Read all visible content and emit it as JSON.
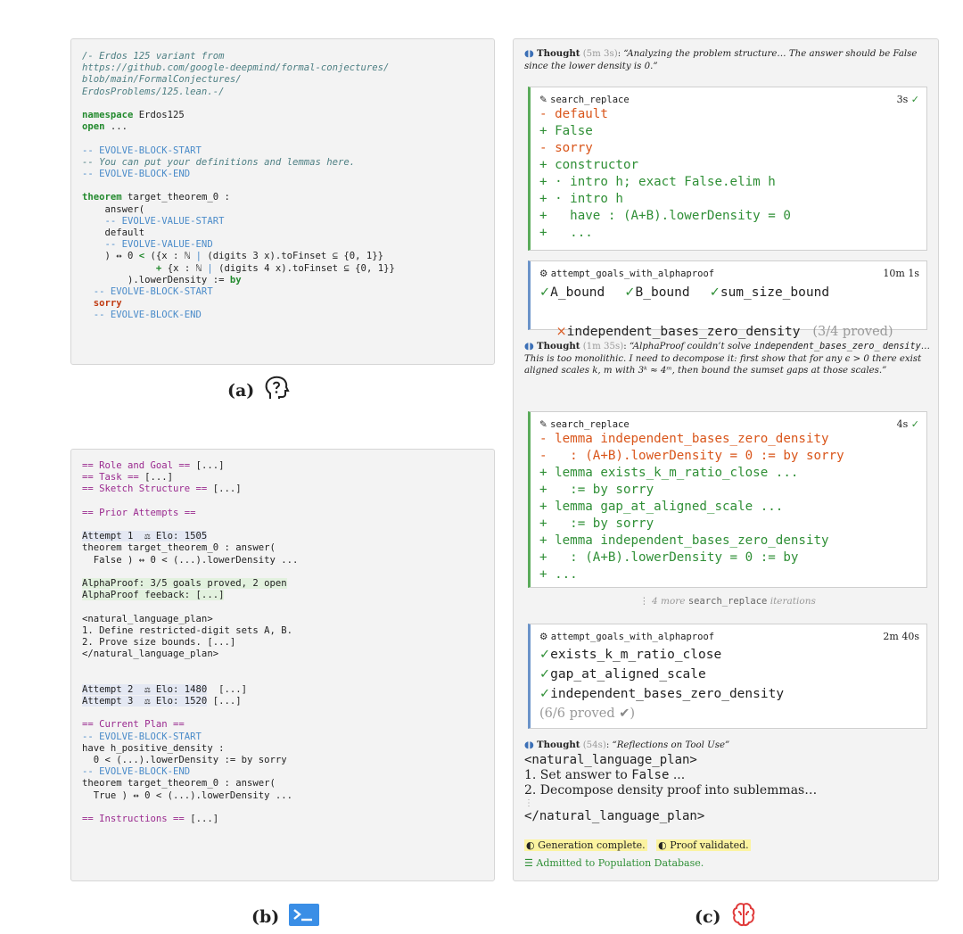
{
  "panel_a": {
    "lines": [
      [
        {
          "t": "/- Erdos 125 variant from",
          "c": "cmi"
        }
      ],
      [
        {
          "t": "https://github.com/google-deepmind/formal-conjectures/",
          "c": "cmi"
        }
      ],
      [
        {
          "t": "blob/main/FormalConjectures/",
          "c": "cmi"
        }
      ],
      [
        {
          "t": "ErdosProblems/125.lean.-/",
          "c": "cmi"
        }
      ],
      [],
      [
        {
          "t": "namespace",
          "c": "kw"
        },
        {
          "t": " Erdos125"
        }
      ],
      [
        {
          "t": "open",
          "c": "kw"
        },
        {
          "t": " ..."
        }
      ],
      [],
      [
        {
          "t": "-- EVOLVE-BLOCK-START",
          "c": "cm"
        }
      ],
      [
        {
          "t": "-- You can put your definitions and lemmas here.",
          "c": "cmi"
        }
      ],
      [
        {
          "t": "-- EVOLVE-BLOCK-END",
          "c": "cm"
        }
      ],
      [],
      [
        {
          "t": "theorem",
          "c": "kw"
        },
        {
          "t": " target_theorem_0 :"
        }
      ],
      [
        {
          "t": "    answer("
        }
      ],
      [
        {
          "t": "    -- EVOLVE-VALUE-START",
          "c": "cm"
        }
      ],
      [
        {
          "t": "    default"
        }
      ],
      [
        {
          "t": "    -- EVOLVE-VALUE-END",
          "c": "cm"
        }
      ],
      [
        {
          "t": "    ) ↔ 0 "
        },
        {
          "t": "<",
          "c": "kw"
        },
        {
          "t": " ({x : ℕ "
        },
        {
          "t": "|",
          "c": "cm"
        },
        {
          "t": " (digits 3 x).toFinset ⊆ {0, 1}}"
        }
      ],
      [
        {
          "t": "             "
        },
        {
          "t": "+",
          "c": "kw"
        },
        {
          "t": " {x : ℕ "
        },
        {
          "t": "|",
          "c": "cm"
        },
        {
          "t": " (digits 4 x).toFinset ⊆ {0, 1}}"
        }
      ],
      [
        {
          "t": "        ).lowerDensity := "
        },
        {
          "t": "by",
          "c": "kw"
        }
      ],
      [
        {
          "t": "  -- EVOLVE-BLOCK-START",
          "c": "cm"
        }
      ],
      [
        {
          "t": "  sorry",
          "c": "red"
        }
      ],
      [
        {
          "t": "  -- EVOLVE-BLOCK-END",
          "c": "cm"
        }
      ]
    ]
  },
  "caption_a": "(a)",
  "panel_b": {
    "lines": [
      [
        {
          "t": "== Role and Goal ==",
          "c": "pu"
        },
        {
          "t": " [...]"
        }
      ],
      [
        {
          "t": "== Task ==",
          "c": "pu"
        },
        {
          "t": " [...]"
        }
      ],
      [
        {
          "t": "== Sketch Structure ==",
          "c": "pu"
        },
        {
          "t": " [...]"
        }
      ],
      [],
      [
        {
          "t": "== Prior Attempts ==",
          "c": "pu"
        }
      ],
      [],
      [
        {
          "t": "Attempt 1  ⚖ Elo: 1505",
          "h": "blue"
        }
      ],
      [
        {
          "t": "theorem target_theorem_0 : answer("
        }
      ],
      [
        {
          "t": "  False ) ↔ 0 < (...).lowerDensity ..."
        }
      ],
      [],
      [
        {
          "t": "AlphaProof: 3/5 goals proved, 2 open",
          "h": "green"
        }
      ],
      [
        {
          "t": "AlphaProof feeback: [...]",
          "h": "green"
        }
      ],
      [],
      [
        {
          "t": "<natural_language_plan>"
        }
      ],
      [
        {
          "t": "1. Define restricted-digit sets A, B."
        }
      ],
      [
        {
          "t": "2. Prove size bounds. [...]"
        }
      ],
      [
        {
          "t": "</natural_language_plan>"
        }
      ],
      [],
      [],
      [
        {
          "t": "Attempt 2  ⚖ Elo: 1480",
          "h": "blue"
        },
        {
          "t": "  [...]"
        }
      ],
      [
        {
          "t": "Attempt 3  ⚖ Elo: 1520",
          "h": "blue"
        },
        {
          "t": " [...]"
        }
      ],
      [],
      [
        {
          "t": "== Current Plan ==",
          "c": "pu"
        }
      ],
      [
        {
          "t": "-- EVOLVE-BLOCK-START",
          "c": "cm"
        }
      ],
      [
        {
          "t": "have h_positive_density :"
        }
      ],
      [
        {
          "t": "  0 < (...).lowerDensity := by sorry"
        }
      ],
      [
        {
          "t": "-- EVOLVE-BLOCK-END",
          "c": "cm"
        }
      ],
      [
        {
          "t": "theorem target_theorem_0 : answer("
        }
      ],
      [
        {
          "t": "  True ) ↔ 0 < (...).lowerDensity ..."
        }
      ],
      [],
      [
        {
          "t": "== Instructions ==",
          "c": "pu"
        },
        {
          "t": " [...]"
        }
      ]
    ]
  },
  "caption_b": "(b)",
  "panel_c": {
    "thought1": {
      "label": "Thought",
      "time": "(5m 3s)",
      "text": "“Analyzing the problem structure… The answer should be False since the lower density is 0.”"
    },
    "edit1": {
      "name": "search_replace",
      "time": "3s",
      "lines": [
        {
          "t": "- default",
          "c": "dr"
        },
        {
          "t": "+ False",
          "c": "dg"
        },
        {
          "t": "- sorry",
          "c": "dr"
        },
        {
          "t": "+ constructor",
          "c": "dg"
        },
        {
          "t": "+ · intro h; exact False.elim h",
          "c": "dg"
        },
        {
          "t": "+ · intro h",
          "c": "dg"
        },
        {
          "t": "+   have : (A+B).lowerDensity = 0",
          "c": "dg"
        },
        {
          "t": "+   ...",
          "c": "dg"
        }
      ]
    },
    "proof1": {
      "name": "attempt_goals_with_alphaproof",
      "time": "10m 1s",
      "row1": [
        {
          "k": "✓",
          "t": "A_bound"
        },
        {
          "k": "✓",
          "t": "B_bound"
        },
        {
          "k": "✓",
          "t": "sum_size_bound"
        }
      ],
      "row2": {
        "k": "×",
        "t": "independent_bases_zero_density",
        "suffix": "(3/4 proved)"
      }
    },
    "thought2": {
      "label": "Thought",
      "time": "(1m 35s)",
      "lead": "“AlphaProof couldn’t solve ",
      "code1": "independent_bases_zero_",
      "code2": "density",
      "rest": "… This is too monolithic. I need to decompose it: first show that for any ϵ > 0 there exist aligned scales k, m with 3ᵏ ≈ 4ᵐ, then bound the sumset gaps at those scales.”"
    },
    "edit2": {
      "name": "search_replace",
      "time": "4s",
      "lines": [
        {
          "t": "- lemma independent_bases_zero_density",
          "c": "dr"
        },
        {
          "t": "-   : (A+B).lowerDensity = 0 := by sorry",
          "c": "dr"
        },
        {
          "t": "+ lemma exists_k_m_ratio_close ...",
          "c": "dg"
        },
        {
          "t": "+   := by sorry",
          "c": "dg"
        },
        {
          "t": "+ lemma gap_at_aligned_scale ...",
          "c": "dg"
        },
        {
          "t": "+   := by sorry",
          "c": "dg"
        },
        {
          "t": "+ lemma independent_bases_zero_density",
          "c": "dg"
        },
        {
          "t": "+   : (A+B).lowerDensity = 0 := by",
          "c": "dg"
        },
        {
          "t": "+ ...",
          "c": "dg"
        }
      ]
    },
    "more": {
      "pre": "4 more",
      "code": "search_replace",
      "post": "iterations"
    },
    "proof2": {
      "name": "attempt_goals_with_alphaproof",
      "time": "2m 40s",
      "rows": [
        {
          "k": "✓",
          "t": "exists_k_m_ratio_close"
        },
        {
          "k": "✓",
          "t": "gap_at_aligned_scale"
        },
        {
          "k": "✓",
          "t": "independent_bases_zero_density"
        }
      ],
      "summary": "(6/6 proved"
    },
    "thought3": {
      "label": "Thought",
      "time": "(54s)",
      "text": "“Reflections on Tool Use”"
    },
    "plan_open": "<natural_language_plan>",
    "plan1_pre": "1. Set answer to ",
    "plan1_code": "False",
    "plan1_post": " ...",
    "plan2": "2. Decompose density proof into sublemmas…",
    "plan_close": "</natural_language_plan>",
    "gen": "Generation complete.",
    "val": "Proof validated.",
    "admit": "Admitted to Population Database."
  },
  "caption_c": "(c)",
  "colors": {
    "green": "#2f8f36",
    "orange": "#d9551a",
    "blue": "#4a8bc9",
    "purple": "#9a2a8f"
  }
}
